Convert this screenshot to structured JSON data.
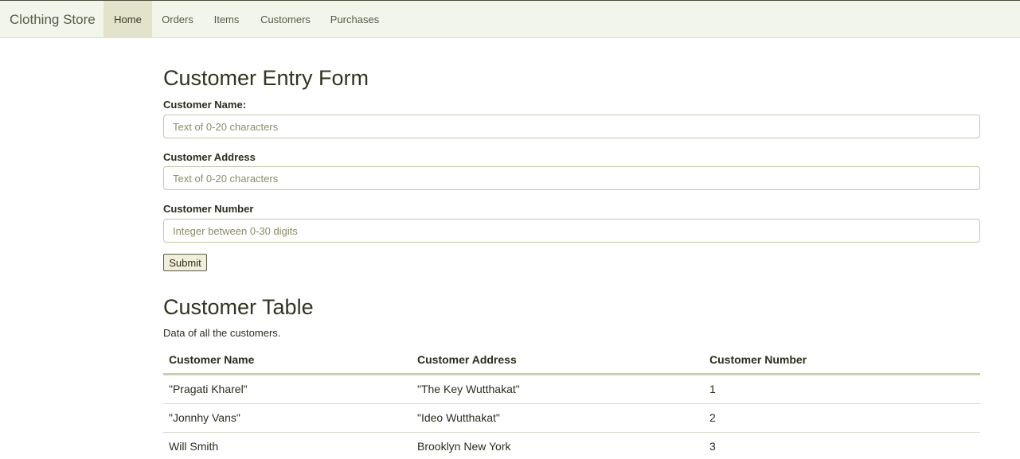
{
  "navbar": {
    "brand": "Clothing Store",
    "items": [
      {
        "label": "Home",
        "active": true
      },
      {
        "label": "Orders",
        "active": false
      },
      {
        "label": "Items",
        "active": false
      },
      {
        "label": "Customers",
        "active": false
      },
      {
        "label": "Purchases",
        "active": false
      }
    ]
  },
  "form": {
    "title": "Customer Entry Form",
    "fields": [
      {
        "label": "Customer Name:",
        "placeholder": "Text of 0-20 characters",
        "value": ""
      },
      {
        "label": "Customer Address",
        "placeholder": "Text of 0-20 characters",
        "value": ""
      },
      {
        "label": "Customer Number",
        "placeholder": "Integer between 0-30 digits",
        "value": ""
      }
    ],
    "submit_label": "Submit"
  },
  "table": {
    "title": "Customer Table",
    "caption": "Data of all the customers.",
    "columns": [
      "Customer Name",
      "Customer Address",
      "Customer Number"
    ],
    "rows": [
      [
        "\"Pragati Kharel\"",
        "\"The Key Wutthakat\"",
        "1"
      ],
      [
        "\"Jonnhy Vans\"",
        "\"Ideo Wutthakat\"",
        "2"
      ],
      [
        "Will Smith",
        "Brooklyn New York",
        "3"
      ]
    ]
  },
  "colors": {
    "navbar_bg": "#f2f5ea",
    "nav_active_bg": "#e3e3cc",
    "text": "#3a3a25",
    "placeholder": "#8c8c66"
  }
}
